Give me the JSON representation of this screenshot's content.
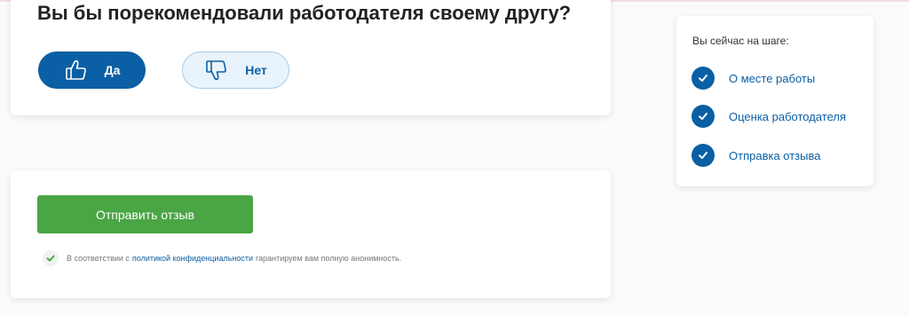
{
  "question": {
    "title": "Вы бы порекомендовали работодателя своему другу?",
    "yes_label": "Да",
    "no_label": "Нет"
  },
  "submit": {
    "button_label": "Отправить отзыв",
    "consent_prefix": "В соответствии с",
    "consent_link": "политикой конфиденциальности",
    "consent_suffix": "гарантируем вам полную анонимность."
  },
  "steps": {
    "title": "Вы сейчас на шаге:",
    "items": [
      {
        "label": "О месте работы",
        "completed": true
      },
      {
        "label": "Оценка работодателя",
        "completed": true
      },
      {
        "label": "Отправка отзыва",
        "completed": true
      }
    ]
  },
  "colors": {
    "primary_blue": "#0b5fa5",
    "light_blue": "#e8f3fb",
    "submit_green": "#4aa544"
  },
  "icons": {
    "yes": "thumbs-up-icon",
    "no": "thumbs-down-icon",
    "check": "check-icon"
  }
}
